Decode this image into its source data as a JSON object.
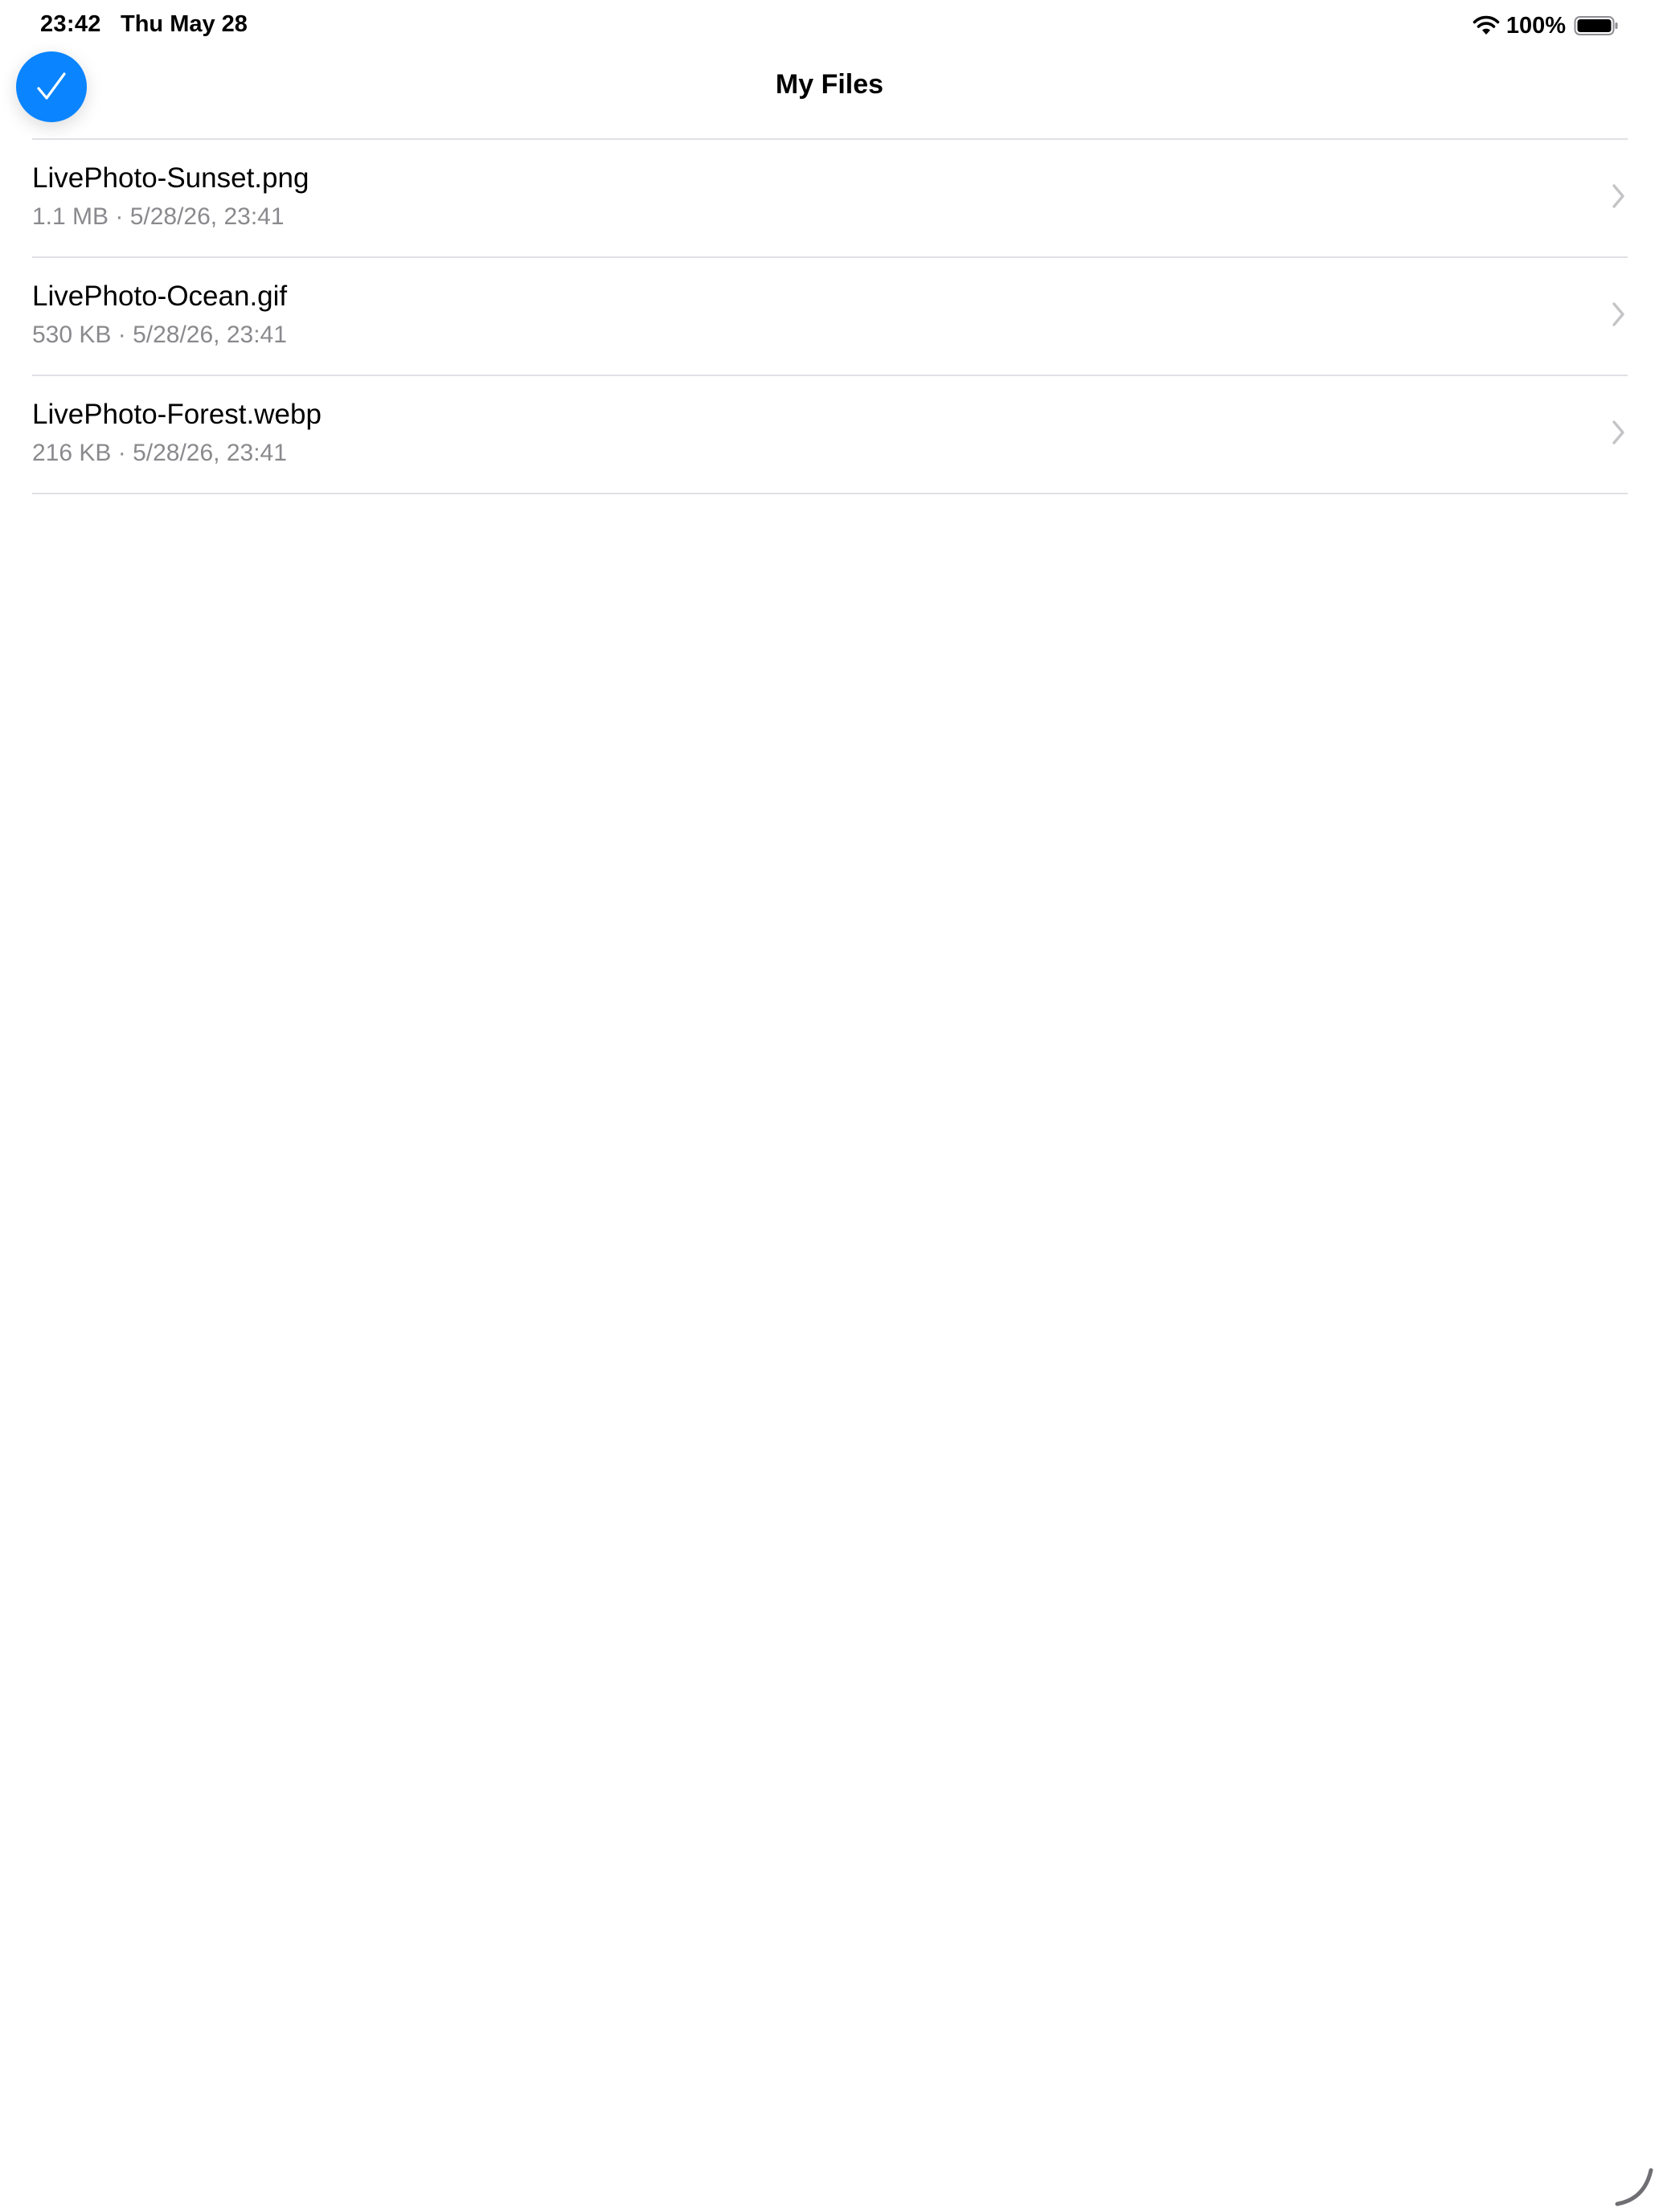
{
  "status_bar": {
    "time": "23:42",
    "date": "Thu May 28",
    "battery_percent": "100%",
    "wifi_icon": "wifi-icon",
    "battery_icon": "battery-full-icon"
  },
  "header": {
    "title": "My Files",
    "edit_button_icon": "checkmark-icon",
    "accent_color": "#0a84ff"
  },
  "files": [
    {
      "name": "LivePhoto-Sunset.png",
      "meta": "1.1 MB · 5/28/26, 23:41"
    },
    {
      "name": "LivePhoto-Ocean.gif",
      "meta": "530 KB · 5/28/26, 23:41"
    },
    {
      "name": "LivePhoto-Forest.webp",
      "meta": "216 KB · 5/28/26, 23:41"
    }
  ]
}
